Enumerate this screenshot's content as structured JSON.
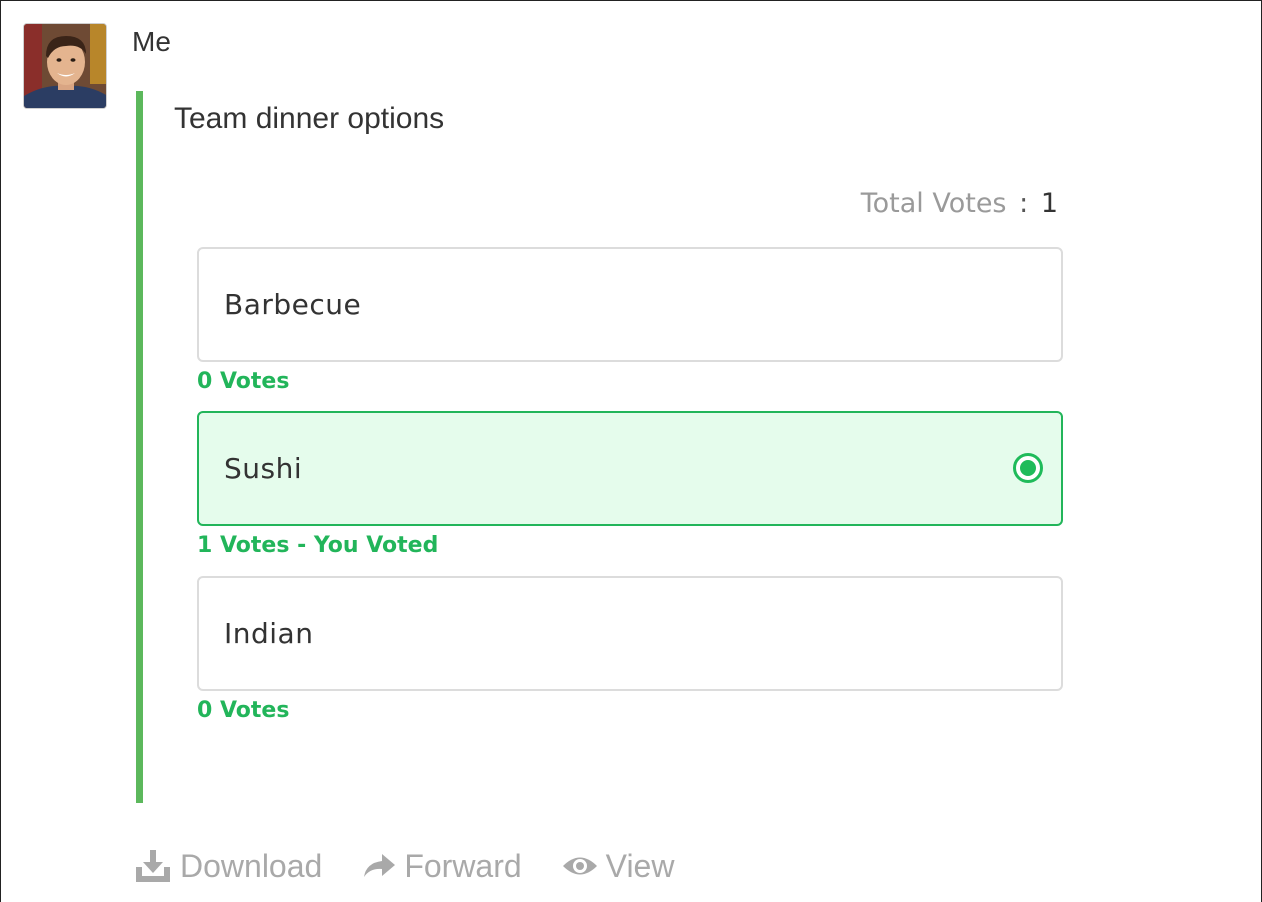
{
  "message": {
    "sender": "Me",
    "avatar_icon": "user-avatar-photo"
  },
  "poll": {
    "title": "Team dinner options",
    "total_votes_label": "Total Votes",
    "total_votes_separator": ":",
    "total_votes_value": "1",
    "options": [
      {
        "label": "Barbecue",
        "votes_text": "0 Votes",
        "selected": false
      },
      {
        "label": "Sushi",
        "votes_text": "1 Votes - You Voted",
        "selected": true
      },
      {
        "label": "Indian",
        "votes_text": "0 Votes",
        "selected": false
      }
    ]
  },
  "actions": {
    "download_label": "Download",
    "download_icon": "download-icon",
    "forward_label": "Forward",
    "forward_icon": "forward-arrow-icon",
    "view_label": "View",
    "view_icon": "eye-icon"
  },
  "colors": {
    "accent_bar": "#5cb85c",
    "vote_green": "#22b55a",
    "selected_bg": "#e5fcec",
    "muted_text": "#a9a9a9"
  }
}
